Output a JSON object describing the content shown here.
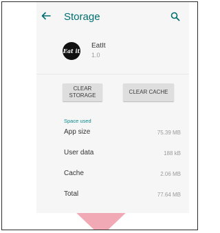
{
  "appbar": {
    "title": "Storage",
    "back_icon": "arrow-left-icon",
    "search_icon": "search-icon"
  },
  "app": {
    "logo_text": "Eat it",
    "name": "EatIt",
    "version": "1.0"
  },
  "actions": {
    "clear_storage_line1": "CLEAR",
    "clear_storage_line2": "STORAGE",
    "clear_cache": "CLEAR CACHE"
  },
  "space_used": {
    "header": "Space used",
    "rows": [
      {
        "label": "App size",
        "value": "75.39 MB"
      },
      {
        "label": "User data",
        "value": "188 kB"
      },
      {
        "label": "Cache",
        "value": "2.06 MB"
      },
      {
        "label": "Total",
        "value": "77.64 MB"
      }
    ]
  },
  "colors": {
    "accent": "#006e6e",
    "section_header": "#0b8a8a",
    "decor_light_pink": "#fbe0e4",
    "decor_pink": "#f2a9b6"
  }
}
